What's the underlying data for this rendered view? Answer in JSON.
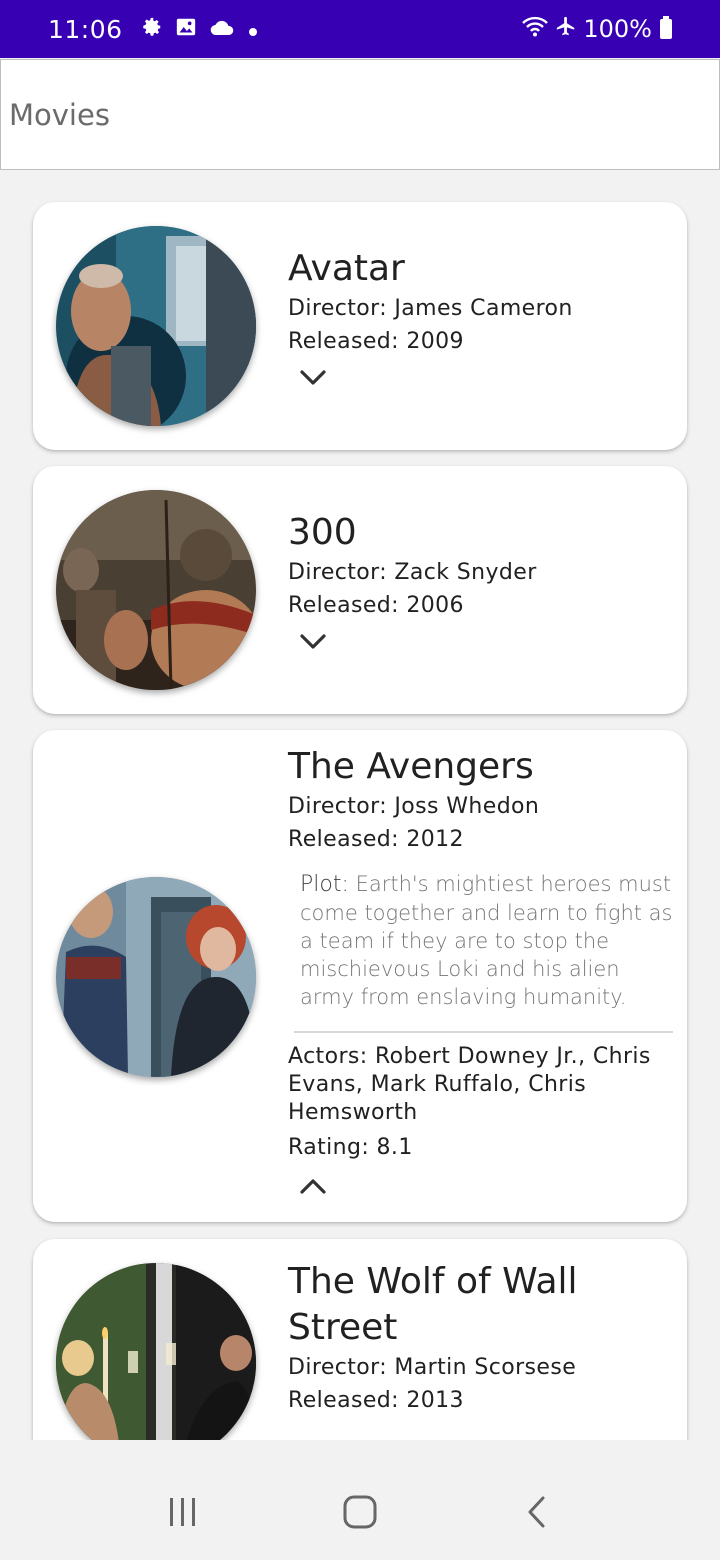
{
  "status_bar": {
    "time": "11:06",
    "battery": "100%",
    "icons": [
      "gear-icon",
      "image-icon",
      "cloud-icon",
      "dot-icon",
      "wifi-icon",
      "airplane-icon",
      "battery-icon"
    ],
    "background": "#3700b3"
  },
  "app_bar": {
    "title": "Movies"
  },
  "movies": [
    {
      "title": "Avatar",
      "director": "Director: James Cameron",
      "released": "Released: 2009",
      "expanded": false,
      "toggle_icon": "chevron-down-icon"
    },
    {
      "title": "300",
      "director": "Director: Zack Snyder",
      "released": "Released: 2006",
      "expanded": false,
      "toggle_icon": "chevron-down-icon"
    },
    {
      "title": "The Avengers",
      "director": "Director: Joss Whedon",
      "released": "Released: 2012",
      "plot_label": "Plot:",
      "plot": "Earth's mightiest heroes must come together and learn to fight as a team if they are to stop the mischievous Loki and his alien army from enslaving humanity.",
      "actors": "Actors: Robert Downey Jr., Chris Evans, Mark Ruffalo, Chris Hemsworth",
      "rating": "Rating: 8.1",
      "expanded": true,
      "toggle_icon": "chevron-up-icon"
    },
    {
      "title": "The Wolf of Wall Street",
      "director": "Director: Martin Scorsese",
      "released": "Released: 2013",
      "expanded": false
    }
  ],
  "nav_bar": {
    "icons": [
      "recents-icon",
      "home-icon",
      "back-icon"
    ]
  }
}
